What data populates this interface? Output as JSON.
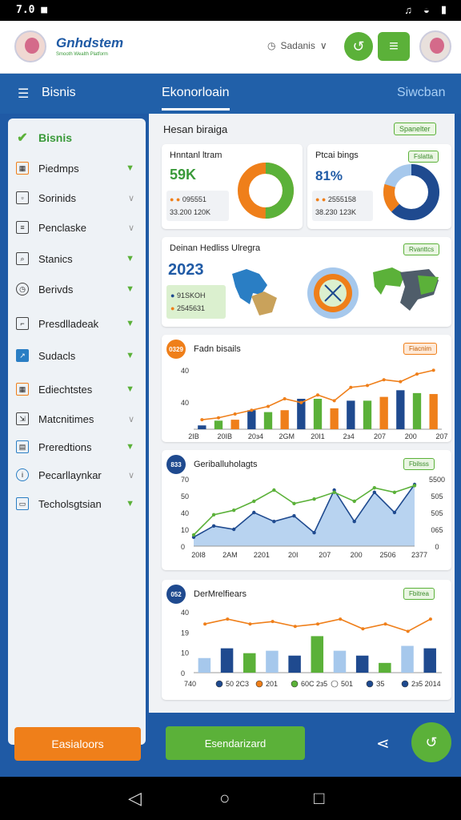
{
  "status": {
    "left": "7.0  ■",
    "right_icons": [
      "signal-icon",
      "wifi-icon",
      "battery-icon"
    ]
  },
  "header": {
    "logo": "Gnhdstem",
    "logo_sub": "Smooth Wealth Platform",
    "selector": "Sadanis",
    "selector_chev": "∨"
  },
  "nav": {
    "menu_label": "Bisnis",
    "tab_active": "Ekonorloain",
    "tab_right": "Siwcban"
  },
  "sidebar": {
    "items": [
      {
        "label": "Bisnis",
        "icon": "check-icon"
      },
      {
        "label": "Piedmps",
        "icon": "chart-icon"
      },
      {
        "label": "Sorinids",
        "icon": "grid-icon"
      },
      {
        "label": "Penclaske",
        "icon": "list-icon"
      },
      {
        "label": "Stanics",
        "icon": "search-icon"
      },
      {
        "label": "Berivds",
        "icon": "clock-icon"
      },
      {
        "label": "Presdlladeak",
        "icon": "doc-icon"
      },
      {
        "label": "Sudacls",
        "icon": "chart-icon"
      },
      {
        "label": "Ediechtstes",
        "icon": "chart-icon"
      },
      {
        "label": "Matcnitimes",
        "icon": "doc-icon"
      },
      {
        "label": "Preredtions",
        "icon": "grid-icon"
      },
      {
        "label": "Pecarllaynkar",
        "icon": "info-icon"
      },
      {
        "label": "Techolsgtsian",
        "icon": "grid-icon"
      }
    ],
    "action": "Easialoors"
  },
  "main": {
    "heading": "Hesan biraiga",
    "heading_badge": "Spanelter",
    "kpi1": {
      "title": "Hnntanl ltram",
      "value": "59K",
      "line1": "095551",
      "line2": "33.200 120K"
    },
    "kpi2": {
      "title": "Ptcai bings",
      "badge": "Fslatta",
      "value": "81%",
      "line1": "2555158",
      "line2": "38.230 123K"
    },
    "map": {
      "title": "Deinan Hedliss Ulregra",
      "badge": "Rvanttcs",
      "year": "2023",
      "l1": "91SKOH",
      "l2": "2545631"
    },
    "chart_badges": {
      "c1": "Fiacnim",
      "c2": "Fbilsss",
      "c3": "Fbitrea"
    },
    "circle_labels": {
      "c1": "0329",
      "c2": "833",
      "c3": "052"
    },
    "footer_action": "Esendarizard"
  },
  "colors": {
    "orange": "#ef7f1a",
    "green": "#5bb139",
    "blue": "#1f4a8f",
    "lightblue": "#a6c8ec"
  },
  "chart_data": [
    {
      "type": "bar",
      "title": "Fadn bisails",
      "yticks": [
        "40",
        "40"
      ],
      "categories": [
        "2IB",
        "20IB",
        "20з4",
        "2GM",
        "20I1",
        "2з4",
        "207",
        "200",
        "207"
      ],
      "series": [
        {
          "values": [
            4,
            8,
            15,
            20,
            22,
            28,
            32,
            41,
            36,
            30,
            35,
            50,
            41,
            46,
            52
          ],
          "color": "#1f4a8f"
        },
        {
          "values": [
            6,
            9,
            12,
            16,
            18,
            22,
            26,
            32,
            28,
            25,
            30,
            42,
            36,
            38,
            44
          ],
          "color": "#5bb139"
        },
        {
          "values": [
            5,
            8,
            10,
            14,
            16,
            20,
            24,
            28,
            22,
            21,
            26,
            34,
            30,
            33,
            37
          ],
          "color": "#ef7f1a"
        }
      ],
      "line": [
        10,
        12,
        16,
        20,
        24,
        32,
        28,
        36,
        30,
        44,
        46,
        52,
        50,
        58,
        62
      ]
    },
    {
      "type": "line",
      "title": "Geriballuholagts",
      "yticks_left": [
        "70",
        "50",
        "40",
        "10",
        "0"
      ],
      "yticks_right": [
        "5500",
        "505",
        "505",
        "065",
        "0"
      ],
      "categories": [
        "20I8",
        "2AM",
        "2201",
        "20I",
        "207",
        "200",
        "2506",
        "2377"
      ],
      "series": [
        {
          "values": [
            8,
            18,
            15,
            30,
            22,
            27,
            12,
            50,
            22,
            48,
            30,
            55
          ],
          "color": "#1f4a8f"
        },
        {
          "values": [
            10,
            28,
            32,
            40,
            50,
            38,
            42,
            48,
            40,
            52,
            48,
            54
          ],
          "color": "#5bb139"
        }
      ]
    },
    {
      "type": "bar",
      "title": "DerMrelfiears",
      "yticks": [
        "40",
        "19",
        "10",
        "0"
      ],
      "legend": [
        "740",
        "50 2C3",
        "201",
        "60C 2з5",
        "501",
        "З5",
        "2з5 2014"
      ],
      "series": [
        {
          "values": [
            12,
            22,
            26,
            18,
            22,
            26,
            18,
            22,
            24,
            22,
            18
          ],
          "color": "#a6c8ec"
        },
        {
          "values": [
            18,
            20,
            20,
            18,
            14,
            16,
            32,
            14,
            36,
            26,
            20
          ],
          "color": "#1f4a8f"
        },
        {
          "values": [
            10,
            18,
            16,
            12,
            28,
            30,
            18,
            36,
            8,
            12,
            16
          ],
          "color": "#5bb139"
        }
      ],
      "line": [
        40,
        44,
        40,
        42,
        38,
        40,
        44,
        36,
        40,
        34,
        44
      ]
    }
  ]
}
